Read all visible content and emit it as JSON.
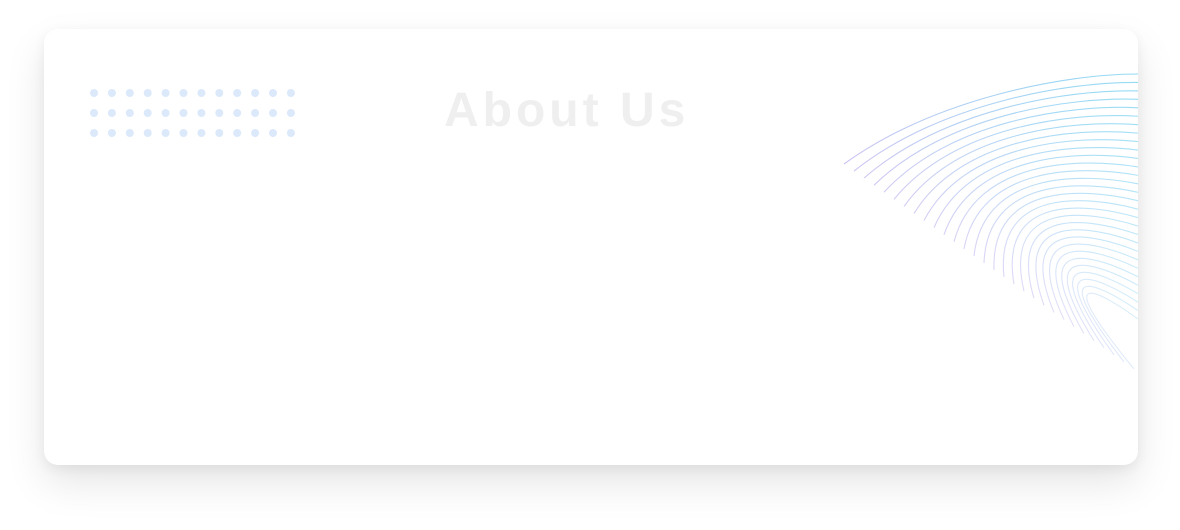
{
  "section": {
    "title": "About Us"
  },
  "decor": {
    "dot_color": "#dce9fb",
    "wave_color_start": "#7fd4f2",
    "wave_color_end": "#c7b8f0",
    "dot_pattern_icon": "dot-grid-icon",
    "wave_lines_icon": "wave-lines-icon"
  }
}
